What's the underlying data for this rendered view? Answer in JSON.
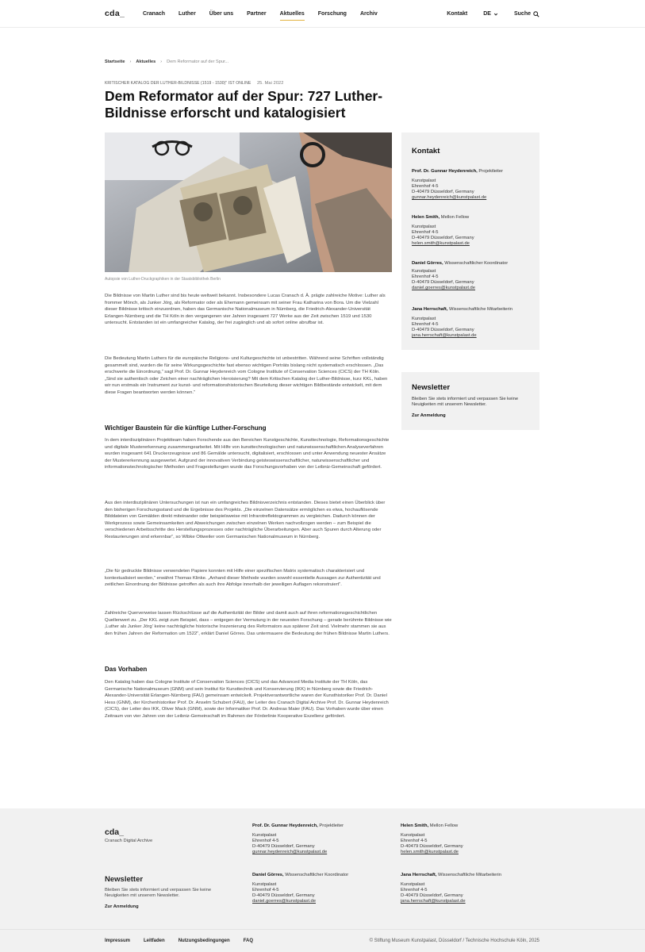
{
  "header": {
    "logo": "cda_",
    "nav": [
      "Cranach",
      "Luther",
      "Über uns",
      "Partner",
      "Aktuelles",
      "Forschung",
      "Archiv"
    ],
    "active_nav": "Aktuelles",
    "contact": "Kontakt",
    "lang": "DE",
    "search": "Suche"
  },
  "breadcrumb": {
    "home": "Startseite",
    "section": "Aktuelles",
    "current": "Dem Reformator auf der Spur..."
  },
  "article": {
    "kicker": "Kritischer Katalog der Luther-Bildnisse (1519 - 1530)\" ist online",
    "date": "25. Mai 2022",
    "title": "Dem Reformator auf der Spur: 727 Luther-Bildnisse erforscht und katalogisiert",
    "image_caption": "Autopsie von Luther-Druckgraphiken in der Staatsbibliothek Berlin",
    "p1": "Die Bildnisse von Martin Luther sind bis heute weltweit bekannt. Insbesondere Lucas Cranach d. Ä. prägte zahlreiche Motive: Luther als frommer Mönch, als Junker Jörg, als Reformator oder als Ehemann gemeinsam mit seiner Frau Katharina von Bora. Um die Vielzahl dieser Bildnisse kritisch einzuordnen, haben das Germanische Nationalmuseum in Nürnberg, die Friedrich-Alexander-Universität Erlangen-Nürnberg und die TH Köln in den vergangenen vier Jahren insgesamt 727 Werke aus der Zeit zwischen 1519 und 1530 untersucht. Entstanden ist ein umfangreicher Katalog, der frei zugänglich und ab sofort online abrufbar ist.",
    "p2": "Die Bedeutung Martin Luthers für die europäische Religions- und Kulturgeschichte ist unbestritten. Während seine Schriften vollständig gesammelt sind, wurden die für seine Wirkungsgeschichte fast ebenso wichtigen Porträts bislang nicht systematisch erschlossen. „Das erschwerte die Einordnung,“ sagt Prof. Dr. Gunnar Heydenreich vom Cologne Institute of Conservation Sciences (CICS) der TH Köln. „Sind sie authentisch oder Zeichen einer nachträglichen Heroisierung? Mit dem Kritischen Katalog der Luther-Bildnisse, kurz KKL, haben wir nun erstmals ein Instrument zur kunst- und reformationshistorischen Beurteilung dieser wichtigen Bildbestände entwickelt, mit dem diese Fragen beantworten werden können.“",
    "h1": "Wichtiger Baustein für die künftige Luther-Forschung",
    "p3": "In dem interdisziplinären Projektteam haben Forschende aus den Bereichen Kunstgeschichte, Kunsttechnologie, Reformationsgeschichte und digitale Mustererkennung zusammengearbeitet. Mit Hilfe von kunsttechnologischen und naturwissenschaftlichen Analyseverfahren wurden insgesamt 641 Druckerzeugnisse und 86 Gemälde untersucht, digitalisiert, erschlossen und unter Anwendung neuester Ansätze der Mustererkennung ausgewertet. Aufgrund der innovativen Verbindung geisteswissenschaftlicher, naturwissenschaftlicher und informationstechnologischer Methoden und Fragestellungen wurde das Forschungsvorhaben von der Leibniz-Gemeinschaft gefördert.",
    "p4": "Aus den interdisziplinären Untersuchungen ist nun ein umfangreiches Bildnisverzeichnis entstanden. Dieses bietet einen Überblick über den bisherigen Forschungsstand und die Ergebnisse des Projekts. „Die einzelnen Datensätze ermöglichen es etwa, hochauflösende Bilddateien von Gemälden direkt miteinander oder beispielsweise mit Infrarotreflektogrammen zu vergleichen. Dadurch können der Werkprozess sowie Gemeinsamkeiten und Abweichungen zwischen einzelnen Werken nachvollzogen werden – zum Beispiel die verschiedenen Arbeitsschritte des Herstellungsprozesses oder nachträgliche Überarbeitungen. Aber auch Spuren durch Alterung oder Restaurierungen sind erkennbar“, so Wibke Ottweiler vom Germanischen Nationalmuseum in Nürnberg.",
    "p5": "„Die für gedruckte Bildnisse verwendeten Papiere konnten mit Hilfe einer spezifischen Matrix systematisch charakterisiert und kontextualisiert werden,“ erwähnt Thomas Klinke. „Anhand dieser Methode wurden sowohl essentielle Aussagen zur Authentizität und zeitlichen Einordnung der Bildnisse getroffen als auch ihre Abfolge innerhalb der jeweiligen Auflagen rekonstruiert“.",
    "p6": "Zahlreiche Querverweise lassen Rückschlüsse auf die Authentizität der Bilder und damit auch auf ihren reformationsgeschichtlichen Quellenwert zu. „Der KKL zeigt zum Beispiel, dass – entgegen der Vermutung in der neuesten Forschung – gerade berühmte Bildnisse wie ‚Luther als Junker Jörg‘ keine nachträgliche historische Inszenierung des Reformators aus späterer Zeit sind. Vielmehr stammen sie aus den frühen Jahren der Reformation um 1522“, erklärt Daniel Görres. Das untermauere die Bedeutung der frühen Bildnisse Martin Luthers.",
    "h2": "Das Vorhaben",
    "p7": "Den Katalog haben das Cologne Institute of Conservation Sciences (CICS) und das Advanced Media Institute der TH Köln, das Germanische Nationalmuseum (GNM) und sein Institut für Kunsttechnik und Konservierung (IKK) in Nürnberg sowie die Friedrich-Alexander-Universität Erlangen-Nürnberg (FAU) gemeinsam entwickelt. Projektverantwortliche waren der Kunsthistoriker Prof. Dr. Daniel Hess (GNM), der Kirchenhistoriker Prof. Dr. Anselm Schubert (FAU), der Leiter des Cranach Digital Archive Prof. Dr. Gunnar Heydenreich (CICS), der Leiter des IKK, Oliver Mack (GNM), sowie der Informatiker Prof. Dr. Andreas Maier (FAU). Das Vorhaben wurde über einen Zeitraum von vier Jahren von der Leibniz-Gemeinschaft im Rahmen der Förderlinie Kooperative Exzellenz gefördert."
  },
  "sidebar": {
    "contact_title": "Kontakt",
    "contacts": [
      {
        "name": "Prof. Dr. Gunnar Heydenreich,",
        "role": " Projektleiter",
        "org": "Kunstpalast",
        "street": "Ehrenhof 4-5",
        "city": "D-40479 Düsseldorf, Germany",
        "email": "gunnar.heydenreich@kunstpalast.de"
      },
      {
        "name": "Helen Smith,",
        "role": " Mellon Fellow",
        "org": "Kunstpalast",
        "street": "Ehrenhof 4-5",
        "city": "D-40479 Düsseldorf, Germany",
        "email": "helen.smith@kunstpalast.de"
      },
      {
        "name": "Daniel Görres,",
        "role": " Wissenschaftlicher Koordinator",
        "org": "Kunstpalast",
        "street": "Ehrenhof 4-5",
        "city": "D-40479 Düsseldorf, Germany",
        "email": "daniel.goerres@kunstpalast.de"
      },
      {
        "name": "Jana Herrschaft,",
        "role": " Wissenschaftliche Mitarbeiterin",
        "org": "Kunstpalast",
        "street": "Ehrenhof 4-5",
        "city": "D-40479 Düsseldorf, Germany",
        "email": "jana.herrschaft@kunstpalast.de"
      }
    ],
    "newsletter_title": "Newsletter",
    "newsletter_text": "Bleiben Sie stets informiert und verpassen Sie keine Neuigkeiten mit unserem Newsletter.",
    "newsletter_link": "Zur Anmeldung"
  },
  "footer": {
    "logo": "cda_",
    "subtitle": "Cranach Digital Archive",
    "newsletter_title": "Newsletter",
    "newsletter_text": "Bleiben Sie stets informiert und verpassen Sie keine Neuigkeiten mit unserem Newsletter.",
    "newsletter_link": "Zur Anmeldung",
    "links": [
      "Impressum",
      "Leitfaden",
      "Nutzungsbedingungen",
      "FAQ"
    ],
    "copyright": "© Stiftung Museum Kunstpalast, Düsseldorf / Technische Hochschule Köln, 2025"
  },
  "colors": {
    "accent": "#e3b341",
    "panel": "#f1f1f1"
  }
}
